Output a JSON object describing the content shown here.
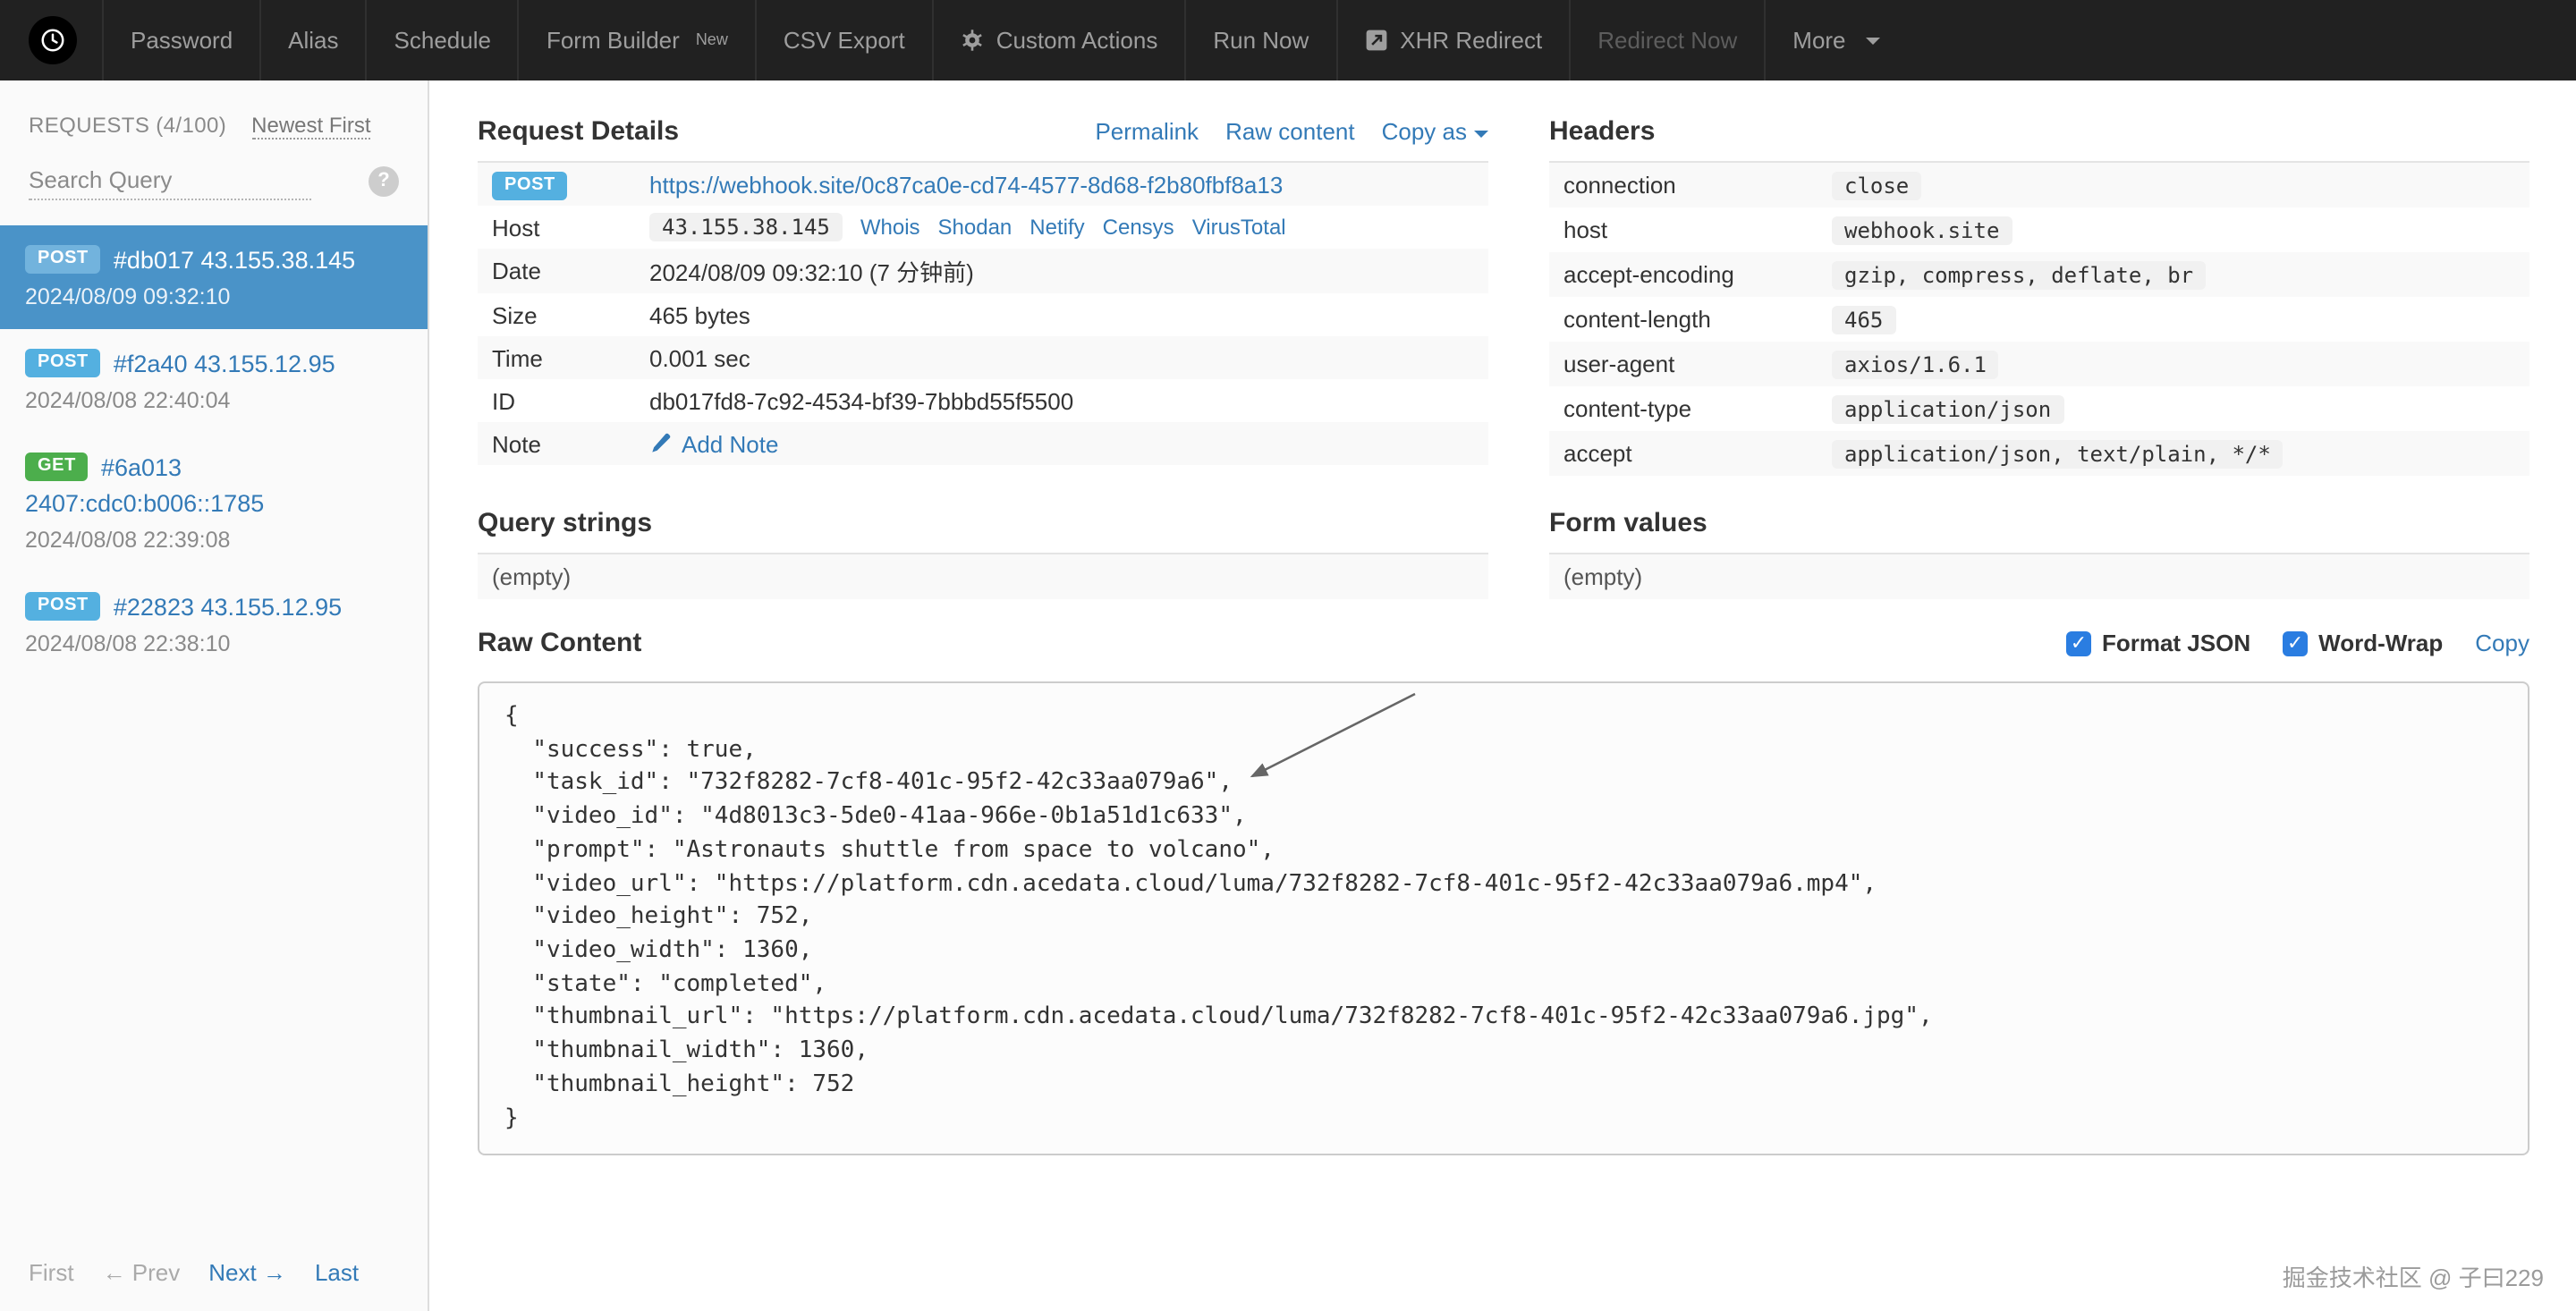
{
  "navbar": {
    "items": [
      {
        "label": "Password"
      },
      {
        "label": "Alias"
      },
      {
        "label": "Schedule"
      },
      {
        "label": "Form Builder",
        "badge": "New"
      },
      {
        "label": "CSV Export"
      },
      {
        "label": "Custom Actions"
      },
      {
        "label": "Run Now"
      },
      {
        "label": "XHR Redirect"
      },
      {
        "label": "Redirect Now"
      },
      {
        "label": "More"
      }
    ]
  },
  "sidebar": {
    "header": "REQUESTS (4/100)",
    "sort_label": "Newest First",
    "search_placeholder": "Search Query",
    "help_glyph": "?",
    "requests": [
      {
        "method": "POST",
        "label": "#db017 43.155.38.145",
        "date": "2024/08/09 09:32:10"
      },
      {
        "method": "POST",
        "label": "#f2a40 43.155.12.95",
        "date": "2024/08/08 22:40:04"
      },
      {
        "method": "GET",
        "label": "#6a013",
        "sub": "2407:cdc0:b006::1785",
        "date": "2024/08/08 22:39:08"
      },
      {
        "method": "POST",
        "label": "#22823 43.155.12.95",
        "date": "2024/08/08 22:38:10"
      }
    ],
    "pagination": {
      "first": "First",
      "prev": "← Prev",
      "next": "Next →",
      "last": "Last"
    }
  },
  "request_details": {
    "title": "Request Details",
    "actions": {
      "permalink": "Permalink",
      "raw_content": "Raw content",
      "copy_as": "Copy as"
    },
    "method": "POST",
    "url": "https://webhook.site/0c87ca0e-cd74-4577-8d68-f2b80fbf8a13",
    "rows": {
      "host": {
        "label": "Host",
        "value": "43.155.38.145"
      },
      "date": {
        "label": "Date",
        "value": "2024/08/09 09:32:10 (7 分钟前)"
      },
      "size": {
        "label": "Size",
        "value": "465 bytes"
      },
      "time": {
        "label": "Time",
        "value": "0.001 sec"
      },
      "id": {
        "label": "ID",
        "value": "db017fd8-7c92-4534-bf39-7bbbd55f5500"
      },
      "note": {
        "label": "Note",
        "action": "Add Note"
      }
    },
    "host_links": [
      "Whois",
      "Shodan",
      "Netify",
      "Censys",
      "VirusTotal"
    ]
  },
  "query_strings": {
    "title": "Query strings",
    "empty": "(empty)"
  },
  "headers": {
    "title": "Headers",
    "rows": [
      {
        "name": "connection",
        "value": "close"
      },
      {
        "name": "host",
        "value": "webhook.site"
      },
      {
        "name": "accept-encoding",
        "value": "gzip, compress, deflate, br"
      },
      {
        "name": "content-length",
        "value": "465"
      },
      {
        "name": "user-agent",
        "value": "axios/1.6.1"
      },
      {
        "name": "content-type",
        "value": "application/json"
      },
      {
        "name": "accept",
        "value": "application/json, text/plain, */*"
      }
    ]
  },
  "form_values": {
    "title": "Form values",
    "empty": "(empty)"
  },
  "raw_content": {
    "title": "Raw Content",
    "format_json_label": "Format JSON",
    "word_wrap_label": "Word-Wrap",
    "copy_label": "Copy",
    "check_glyph": "✓",
    "body": "{\n  \"success\": true,\n  \"task_id\": \"732f8282-7cf8-401c-95f2-42c33aa079a6\",\n  \"video_id\": \"4d8013c3-5de0-41aa-966e-0b1a51d1c633\",\n  \"prompt\": \"Astronauts shuttle from space to volcano\",\n  \"video_url\": \"https://platform.cdn.acedata.cloud/luma/732f8282-7cf8-401c-95f2-42c33aa079a6.mp4\",\n  \"video_height\": 752,\n  \"video_width\": 1360,\n  \"state\": \"completed\",\n  \"thumbnail_url\": \"https://platform.cdn.acedata.cloud/luma/732f8282-7cf8-401c-95f2-42c33aa079a6.jpg\",\n  \"thumbnail_width\": 1360,\n  \"thumbnail_height\": 752\n}"
  },
  "watermark": "掘金技术社区 @ 子曰229",
  "icons": {
    "clock": "clock-face",
    "gear": "cog",
    "xhr_redirect": "arrow-square",
    "caret_down": "triangle-down",
    "help": "question-circle",
    "pencil": "pencil",
    "annotation_arrow": "diagonal-arrow"
  },
  "colors": {
    "navbar_bg": "#212121",
    "accent_link": "#337ab7",
    "selected_request_bg": "#4a93c8",
    "post_badge": "#54b0e0",
    "get_badge": "#4cae4c",
    "checkbox_blue": "#2a7de1",
    "stripe": "#f9f9f9"
  }
}
